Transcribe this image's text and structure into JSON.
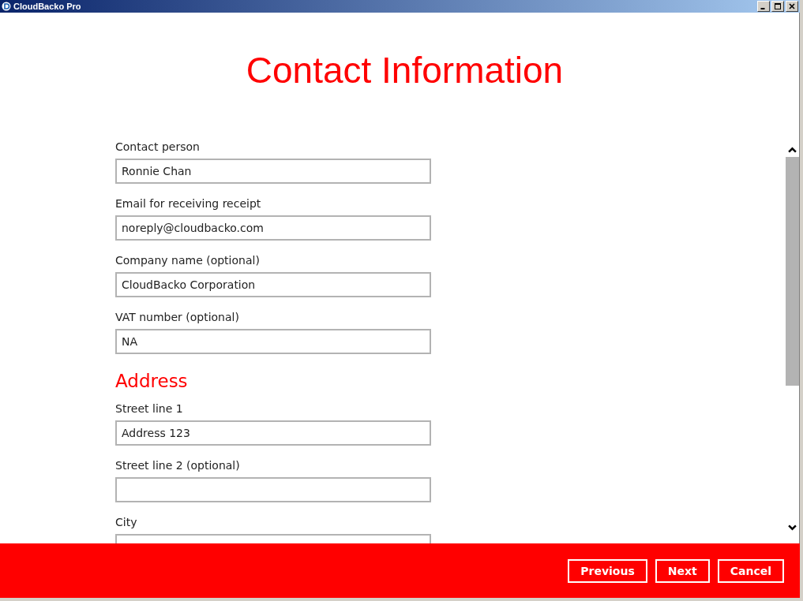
{
  "window": {
    "title": "CloudBacko Pro"
  },
  "page_title": "Contact Information",
  "form": [
    {
      "kind": "field",
      "label": "Contact person",
      "value": "Ronnie Chan"
    },
    {
      "kind": "field",
      "label": "Email for receiving receipt",
      "value": "noreply@cloudbacko.com"
    },
    {
      "kind": "field",
      "label": "Company name (optional)",
      "value": "CloudBacko Corporation"
    },
    {
      "kind": "field",
      "label": "VAT number (optional)",
      "value": "NA"
    },
    {
      "kind": "heading",
      "label": "Address"
    },
    {
      "kind": "field",
      "label": "Street line 1",
      "value": "Address 123"
    },
    {
      "kind": "field",
      "label": "Street line 2 (optional)"
    },
    {
      "kind": "field",
      "label": "City"
    }
  ],
  "buttons": [
    "Previous",
    "Next",
    "Cancel"
  ]
}
